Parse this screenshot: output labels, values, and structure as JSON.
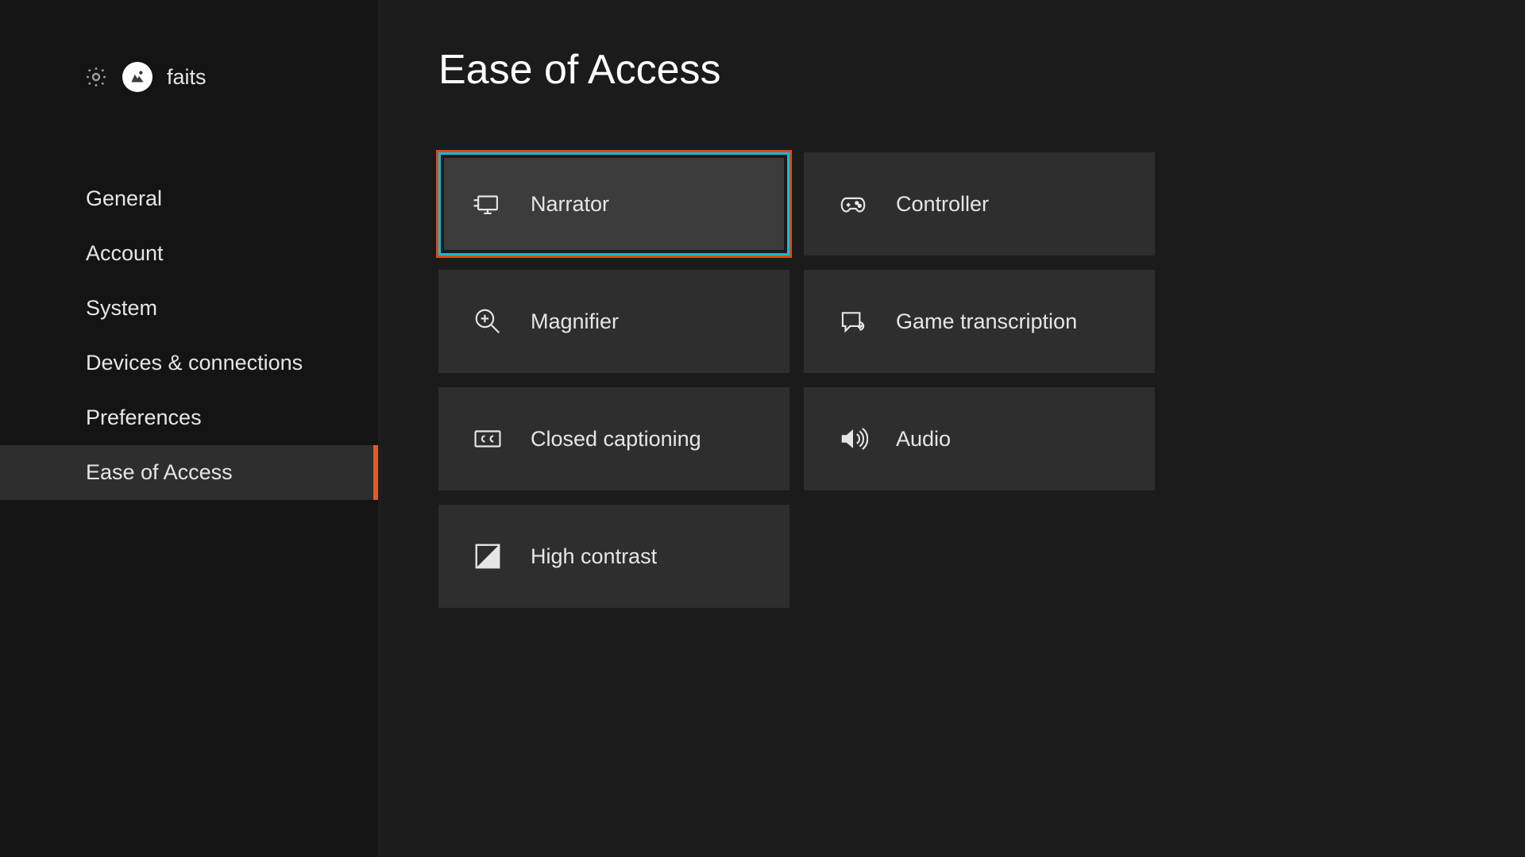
{
  "header": {
    "username": "faits"
  },
  "sidebar": {
    "items": [
      {
        "label": "General"
      },
      {
        "label": "Account"
      },
      {
        "label": "System"
      },
      {
        "label": "Devices & connections"
      },
      {
        "label": "Preferences"
      },
      {
        "label": "Ease of Access"
      }
    ],
    "active_index": 5
  },
  "main": {
    "title": "Ease of Access",
    "tiles": [
      {
        "label": "Narrator",
        "icon": "narrator",
        "focused": true
      },
      {
        "label": "Controller",
        "icon": "controller",
        "focused": false
      },
      {
        "label": "Magnifier",
        "icon": "magnifier",
        "focused": false
      },
      {
        "label": "Game transcription",
        "icon": "transcript",
        "focused": false
      },
      {
        "label": "Closed captioning",
        "icon": "cc",
        "focused": false
      },
      {
        "label": "Audio",
        "icon": "audio",
        "focused": false
      },
      {
        "label": "High contrast",
        "icon": "contrast",
        "focused": false
      }
    ]
  },
  "colors": {
    "accent": "#e75a24",
    "focus_ring": "#18b7d4",
    "bg": "#1b1b1b",
    "sidebar_bg": "#141414",
    "tile_bg": "#2e2e2e"
  }
}
